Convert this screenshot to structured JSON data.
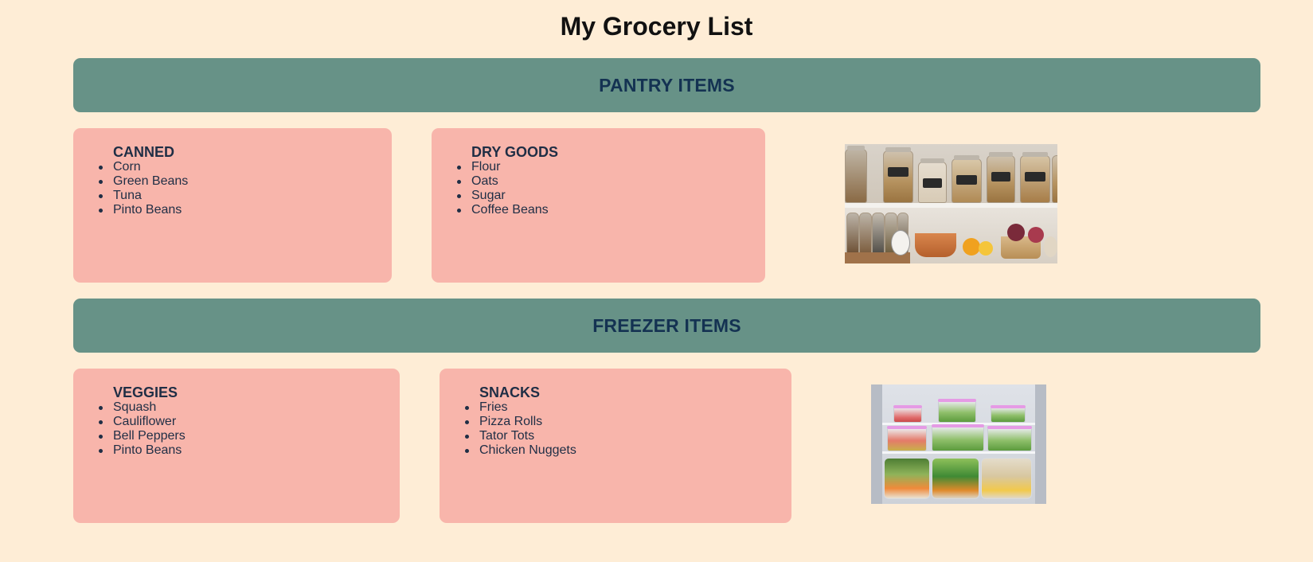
{
  "page": {
    "title": "My Grocery List"
  },
  "sections": {
    "pantry": {
      "heading": "PANTRY ITEMS",
      "cards": [
        {
          "title": "CANNED",
          "items": [
            "Corn",
            "Green Beans",
            "Tuna",
            "Pinto Beans"
          ]
        },
        {
          "title": "DRY GOODS",
          "items": [
            "Flour",
            "Oats",
            "Sugar",
            "Coffee Beans"
          ]
        }
      ]
    },
    "freezer": {
      "heading": "FREEZER ITEMS",
      "cards": [
        {
          "title": "VEGGIES",
          "items": [
            "Squash",
            "Cauliflower",
            "Bell Peppers",
            "Pinto Beans"
          ]
        },
        {
          "title": "SNACKS",
          "items": [
            "Fries",
            "Pizza Rolls",
            "Tator Tots",
            "Chicken Nuggets"
          ]
        }
      ]
    }
  },
  "colors": {
    "background": "#feedd6",
    "banner": "#679287",
    "banner_text": "#143252",
    "card": "#f8b5ab",
    "card_text": "#1f2e45"
  }
}
